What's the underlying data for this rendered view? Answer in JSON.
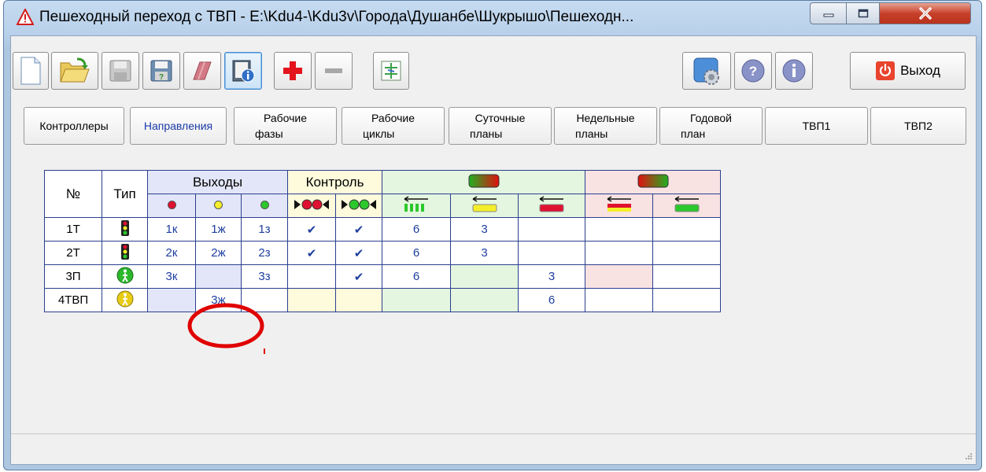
{
  "window": {
    "title": "Пешеходный переход с ТВП - E:\\Kdu4-\\Kdu3v\\Города\\Душанбе\\Шукрышо\\Пешеходн...",
    "colors": {
      "titlebar": "#b9d1ea",
      "close": "#c7402a"
    }
  },
  "toolbar": {
    "exit_label": "Выход",
    "icons": [
      "new-file-icon",
      "open-folder-icon",
      "save-icon",
      "save-as-icon",
      "eraser-icon",
      "info-book-icon",
      "add-icon",
      "remove-icon",
      "compare-icon",
      "settings-icon",
      "help-icon",
      "about-icon",
      "power-icon"
    ]
  },
  "tabs": [
    {
      "line1": "Контроллеры",
      "line2": ""
    },
    {
      "line1": "Направления",
      "line2": ""
    },
    {
      "line1": "Рабочие",
      "line2": "фазы"
    },
    {
      "line1": "Рабочие",
      "line2": "циклы"
    },
    {
      "line1": "Суточные",
      "line2": "планы"
    },
    {
      "line1": "Недельные",
      "line2": "планы"
    },
    {
      "line1": "Годовой",
      "line2": "план"
    },
    {
      "line1": "ТВП1",
      "line2": ""
    },
    {
      "line1": "ТВП2",
      "line2": ""
    }
  ],
  "table": {
    "headers": {
      "num": "№",
      "type": "Тип",
      "outputs": "Выходы",
      "control": "Контроль"
    },
    "rows": [
      {
        "num": "1Т",
        "type": "traffic-light-icon",
        "red": "1к",
        "yellow": "1ж",
        "green": "1з",
        "ctrl_red": "✔",
        "ctrl_green": "✔",
        "g1": "6",
        "g2": "3",
        "g3": "",
        "p1": "",
        "p2": ""
      },
      {
        "num": "2Т",
        "type": "traffic-light-icon",
        "red": "2к",
        "yellow": "2ж",
        "green": "2з",
        "ctrl_red": "✔",
        "ctrl_green": "✔",
        "g1": "6",
        "g2": "3",
        "g3": "",
        "p1": "",
        "p2": ""
      },
      {
        "num": "3П",
        "type": "pedestrian-green-icon",
        "red": "3к",
        "yellow": "",
        "green": "3з",
        "ctrl_red": "",
        "ctrl_green": "✔",
        "g1": "6",
        "g2": "",
        "g3": "3",
        "p1": "",
        "p2": ""
      },
      {
        "num": "4ТВП",
        "type": "pedestrian-yellow-icon",
        "red": "",
        "yellow": "3ж",
        "green": "",
        "ctrl_red": "",
        "ctrl_green": "",
        "g1": "",
        "g2": "",
        "g3": "6",
        "p1": "",
        "p2": ""
      }
    ]
  },
  "annotation_color": "#e00000"
}
